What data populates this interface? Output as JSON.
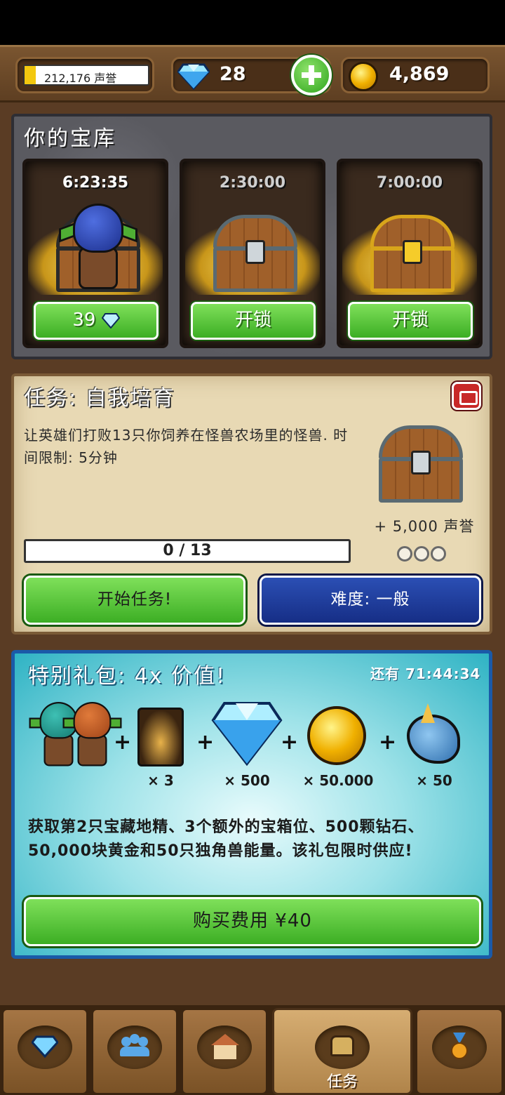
{
  "topbar": {
    "reputation": "212,176 声誉",
    "gems": "28",
    "gold": "4,869"
  },
  "vault": {
    "title": "你的宝库",
    "slots": [
      {
        "timer": "6:23:35",
        "button": "39",
        "button_icon": "diamond-icon"
      },
      {
        "timer": "2:30:00",
        "button": "开锁"
      },
      {
        "timer": "7:00:00",
        "button": "开锁"
      }
    ]
  },
  "mission": {
    "title": "任务: 自我培育",
    "description": "让英雄们打败13只你饲养在怪兽农场里的怪兽. 时间限制: 5分钟",
    "reward": "+ 5,000 声誉",
    "progress_text": "0 / 13",
    "progress": 0,
    "start_label": "开始任务!",
    "difficulty_label": "难度: 一般"
  },
  "offer": {
    "title": "特别礼包: 4x 价值!",
    "timer": "还有 71:44:34",
    "items": [
      {
        "name": "goblins-icon",
        "qty": ""
      },
      {
        "name": "chest-slot-icon",
        "qty": "× 3"
      },
      {
        "name": "diamond-icon",
        "qty": "× 500"
      },
      {
        "name": "gold-coin-icon",
        "qty": "× 50.000"
      },
      {
        "name": "unicorn-icon",
        "qty": "× 50"
      }
    ],
    "description": "获取第2只宝藏地精、3个额外的宝箱位、500颗钻石、50,000块黄金和50只独角兽能量。该礼包限时供应!",
    "buy_label": "购买费用 ¥40"
  },
  "nav": {
    "tabs": [
      {
        "icon": "diamond-icon",
        "label": ""
      },
      {
        "icon": "heroes-icon",
        "label": ""
      },
      {
        "icon": "house-icon",
        "label": ""
      },
      {
        "icon": "chest-icon",
        "label": "任务"
      },
      {
        "icon": "medal-icon",
        "label": ""
      }
    ]
  },
  "colors": {
    "accent_green": "#3cae24",
    "accent_blue": "#162e86",
    "offer_bg": "#2fb3c4"
  }
}
